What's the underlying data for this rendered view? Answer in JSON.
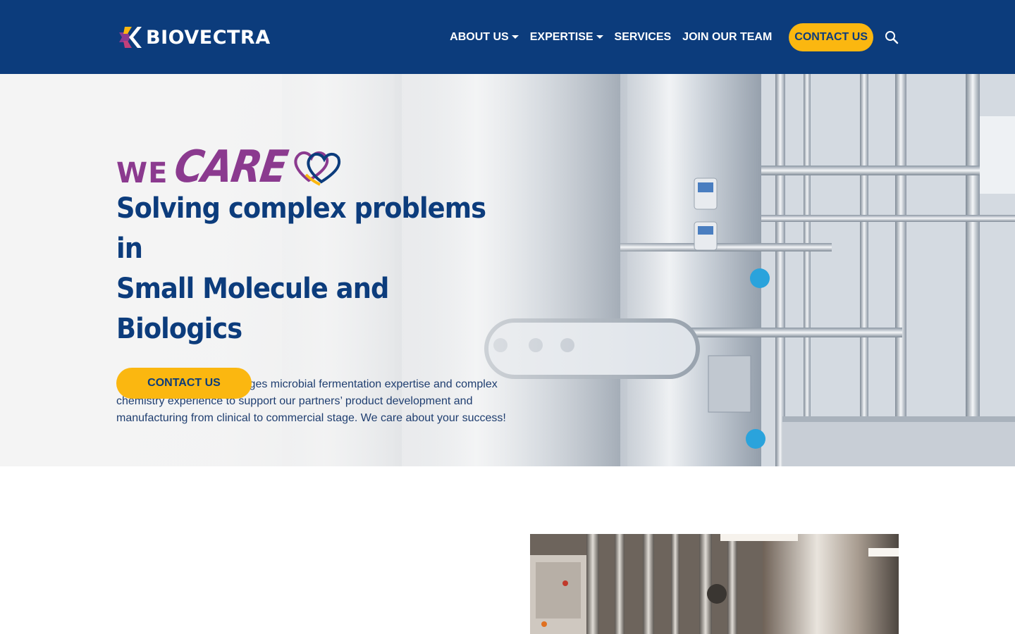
{
  "header": {
    "brand": "BIOVECTRA",
    "nav": [
      {
        "label": "ABOUT US",
        "dropdown": true
      },
      {
        "label": "EXPERTISE",
        "dropdown": true
      },
      {
        "label": "SERVICES",
        "dropdown": false
      },
      {
        "label": "JOIN OUR TEAM",
        "dropdown": false
      }
    ],
    "cta_label": "CONTACT US",
    "search_icon": "search-icon"
  },
  "hero": {
    "tagline_we": "WE",
    "tagline_care": "CARE",
    "headline_line1": "Solving complex problems in",
    "headline_line2": "Small Molecule and Biologics",
    "description": "Our dedicated team leverages microbial fermentation expertise and complex chemistry experience to support our partners’ product development and manufacturing from clinical to commercial stage. We care about your success!",
    "button_label": "CONTACT US"
  },
  "colors": {
    "header_bg": "#0c3c7c",
    "accent_yellow": "#fbb710",
    "brand_purple": "#8b3a8f",
    "navy_text": "#0c3c7c"
  }
}
